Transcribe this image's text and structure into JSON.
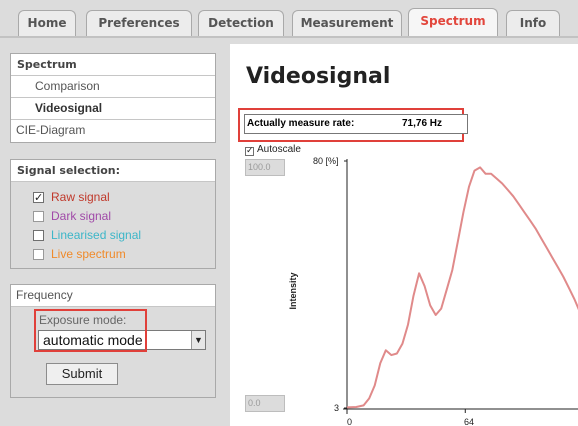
{
  "tabs": [
    {
      "label": "Home",
      "active": false
    },
    {
      "label": "Preferences",
      "active": false
    },
    {
      "label": "Detection",
      "active": false
    },
    {
      "label": "Measurement",
      "active": false
    },
    {
      "label": "Spectrum",
      "active": true
    },
    {
      "label": "Info",
      "active": false
    }
  ],
  "nav": {
    "header": "Spectrum",
    "items": [
      {
        "label": "Comparison",
        "selected": false
      },
      {
        "label": "Videosignal",
        "selected": true
      }
    ],
    "cie": "CIE-Diagram"
  },
  "signal_selection": {
    "header": "Signal selection:",
    "items": [
      {
        "label": "Raw signal",
        "checked": true,
        "color": "#c0392b"
      },
      {
        "label": "Dark signal",
        "checked": false,
        "color": "#a04aa8"
      },
      {
        "label": "Linearised signal",
        "checked": false,
        "color": "#3cb6c8"
      },
      {
        "label": "Live spectrum",
        "checked": false,
        "color": "#f08a2a"
      }
    ]
  },
  "frequency": {
    "header": "Frequency",
    "exposure_label": "Exposure mode:",
    "exposure_value": "automatic mode",
    "submit_label": "Submit"
  },
  "main": {
    "title": "Videosignal",
    "rate_label": "Actually measure rate:",
    "rate_value": "71,76 Hz",
    "autoscale_label": "Autoscale",
    "autoscale_checked": true,
    "scale_max": "100.0",
    "scale_min": "0.0"
  },
  "chart_data": {
    "type": "line",
    "title": "",
    "xlabel": "",
    "ylabel": "Intensity",
    "y_unit_label": "80 [%]",
    "y_bottom_label": "3",
    "xticks": [
      "0",
      "64"
    ],
    "xlim": [
      0,
      125
    ],
    "ylim": [
      3,
      80
    ],
    "series": [
      {
        "color": "#e08a8a",
        "x": [
          0,
          5,
          9,
          12,
          15,
          18,
          21,
          24,
          27,
          30,
          33,
          36,
          39,
          42,
          45,
          48,
          51,
          54,
          57,
          60,
          63,
          66,
          69,
          72,
          75,
          78,
          81,
          84,
          87,
          90,
          93,
          96,
          99,
          102,
          105,
          108,
          111,
          114,
          117,
          120,
          123,
          126
        ],
        "y": [
          3.2,
          3.3,
          3.8,
          6,
          10,
          17,
          21,
          19.5,
          20,
          23,
          29,
          38,
          45,
          41,
          35,
          32,
          34,
          40,
          46,
          55,
          64,
          72,
          77,
          78,
          76,
          76,
          74.5,
          73,
          71,
          69,
          66.5,
          64,
          61.5,
          59,
          56,
          53,
          50,
          47,
          44,
          40.5,
          37,
          33
        ]
      }
    ]
  }
}
